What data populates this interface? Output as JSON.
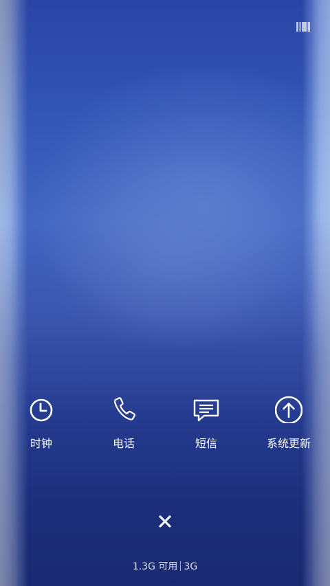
{
  "top_bar": {
    "task_manager_icon": "task-manager-icon"
  },
  "shortcuts": [
    {
      "label": "时钟",
      "icon": "clock-icon"
    },
    {
      "label": "电话",
      "icon": "phone-icon"
    },
    {
      "label": "短信",
      "icon": "message-icon"
    },
    {
      "label": "系统更新",
      "icon": "arrow-up-circle-icon"
    }
  ],
  "close": {
    "icon": "close-icon"
  },
  "memory": {
    "available": "1.3G 可用",
    "total": "3G"
  },
  "colors": {
    "background_top": "#2a44a6",
    "background_mid": "#4266c2",
    "background_bottom": "#1a2a72",
    "foreground": "#ffffff"
  }
}
